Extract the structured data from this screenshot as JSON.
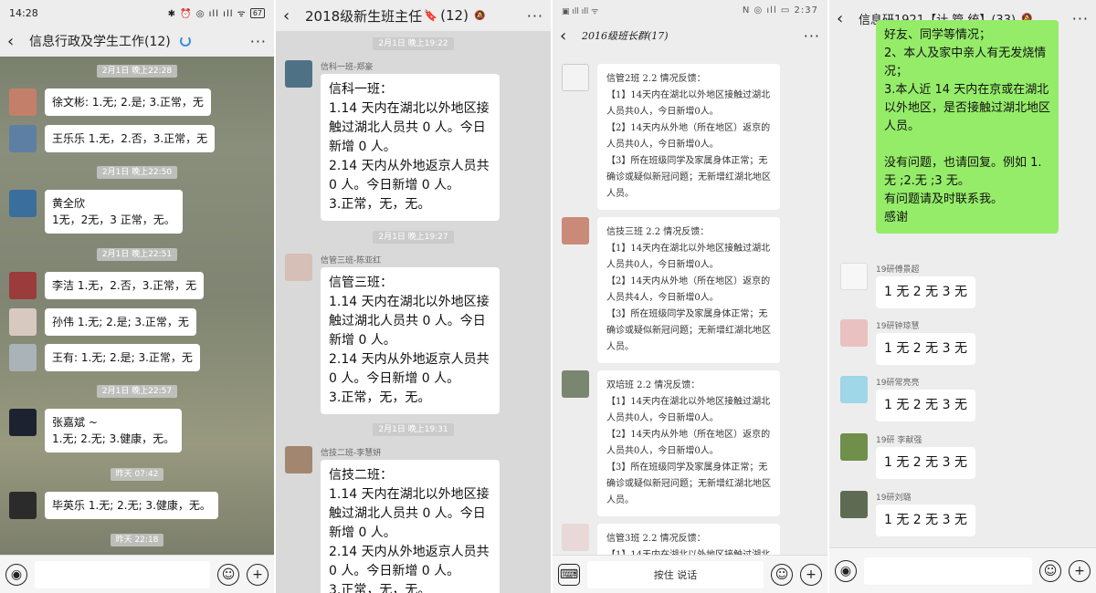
{
  "panel1": {
    "status_time": "14:28",
    "status_icons": "✱ ⏰ ◎ ıll ıll ᯤ",
    "battery": "67",
    "title": "信息行政及学生工作(12)",
    "messages": [
      {
        "time": "2月1日 晚上22:28"
      },
      {
        "text": "徐文彬: 1.无; 2.是; 3.正常，无"
      },
      {
        "text": "王乐乐 1.无，2.否，3.正常，无"
      },
      {
        "time": "2月1日 晚上22:50"
      },
      {
        "text": "黄全欣\n1无，2无，3 正常，无。"
      },
      {
        "time": "2月1日 晚上22:51"
      },
      {
        "text": "李洁 1.无，2.否，3.正常，无"
      },
      {
        "text": "孙伟 1.无; 2.是; 3.正常，无"
      },
      {
        "text": "王有: 1.无; 2.是; 3.正常，无"
      },
      {
        "time": "2月1日 晚上22:57"
      },
      {
        "text": "张嘉斌 ~\n1.无; 2.无; 3.健康，无。"
      },
      {
        "time": "昨天 07:42"
      },
      {
        "text": "毕英乐 1.无; 2.无; 3.健康，无。"
      },
      {
        "time": "昨天 22:18"
      }
    ]
  },
  "panel2": {
    "title": "2018级新生班主任",
    "title_count": "(12)",
    "messages": [
      {
        "time": "2月1日 晚上19:22"
      },
      {
        "name": "信科一班-郑豪",
        "text": "信科一班：\n1.14 天内在湖北以外地区接触过湖北人员共 0 人。今日新增 0 人。\n2.14 天内从外地返京人员共 0 人。今日新增 0 人。\n3.正常，无，无。"
      },
      {
        "time": "2月1日 晚上19:27"
      },
      {
        "name": "信管三班-陈亚红",
        "text": "信管三班：\n1.14 天内在湖北以外地区接触过湖北人员共 0 人。今日新增 0 人。\n2.14 天内从外地返京人员共 0 人。今日新增 0 人。\n3.正常，无，无。"
      },
      {
        "time": "2月1日 晚上19:31"
      },
      {
        "name": "信技二班-李慧妍",
        "text": "信技二班：\n1.14 天内在湖北以外地区接触过湖北人员共 0 人。今日新增 0 人。\n2.14 天内从外地返京人员共 0 人。今日新增 0 人。\n3.正常，无，无。"
      }
    ]
  },
  "panel3": {
    "status_left": "▣ ıll ıll ᯤ",
    "status_right": "N ◎ ıll ▭ 2:37",
    "title": "2016级班长群(17)",
    "input_placeholder": "按住 说话",
    "messages": [
      {
        "text": "信管2班 2.2 情况反馈：\n【1】14天内在湖北以外地区接触过湖北人员共0人，今日新增0人。\n【2】14天内从外地（所在地区）返京的人员共0人，今日新增0人。\n【3】所在班级同学及家属身体正常；无确诊或疑似新冠问题；无新增红湖北地区人员。"
      },
      {
        "text": "信技三班 2.2 情况反馈：\n【1】14天内在湖北以外地区接触过湖北人员共0人，今日新增0人。\n【2】14天内从外地（所在地区）返京的人员共4人，今日新增0人。\n【3】所在班级同学及家属身体正常；无确诊或疑似新冠问题；无新增红湖北地区人员。"
      },
      {
        "text": "双培班 2.2 情况反馈：\n【1】14天内在湖北以外地区接触过湖北人员共0人，今日新增0人。\n【2】14天内从外地（所在地区）返京的人员共0人，今日新增0人。\n【3】所在班级同学及家属身体正常；无确诊或疑似新冠问题；无新增红湖北地区人员。"
      },
      {
        "text": "信管3班 2.2 情况反馈：\n【1】14天内在湖北以外地区接触过湖北人员..."
      }
    ]
  },
  "panel4": {
    "title": "信息研1921【计 管 统】(33)",
    "own_text": "好友、同学等情况；\n2、本人及家中亲人有无发烧情况；\n3.本人近 14 天内在京或在湖北以外地区，是否接触过湖北地区人员。\n\n没有问题，也请回复。例如 1.无 ;2.无 ;3 无。\n有问题请及时联系我。\n感谢",
    "messages": [
      {
        "name": "19研傅景超",
        "text": "1 无 2 无 3 无"
      },
      {
        "name": "19研钟琼慧",
        "text": "1 无 2 无 3 无"
      },
      {
        "name": "19研常亮亮",
        "text": "1 无 2 无 3 无"
      },
      {
        "name": "19研 李献强",
        "text": "1 无 2 无 3 无"
      },
      {
        "name": "19研刘璐",
        "text": "1 无 2 无 3 无"
      }
    ]
  }
}
